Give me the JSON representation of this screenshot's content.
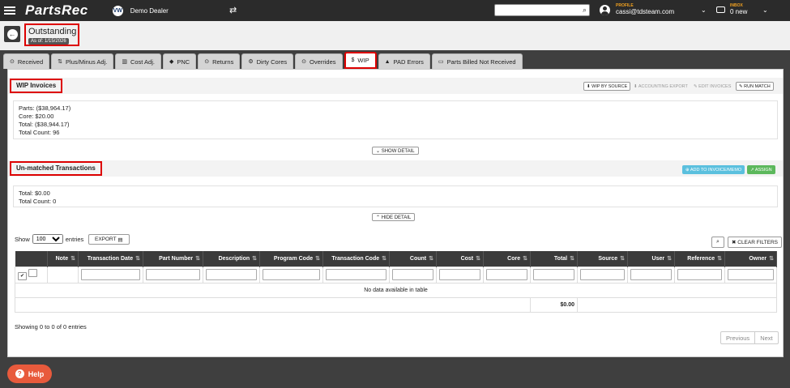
{
  "topbar": {
    "logo": "PartsRec",
    "dealer": "Demo Dealer",
    "profile_label": "PROFILE",
    "profile_email": "cassi@tdsteam.com",
    "inbox_label": "INBOX",
    "inbox_count": "0 new"
  },
  "header": {
    "title": "Outstanding",
    "as_of": "As of: 1/15/2026"
  },
  "tabs": [
    {
      "icon": "⊙",
      "label": "Received"
    },
    {
      "icon": "⇅",
      "label": "Plus/Minus Adj."
    },
    {
      "icon": "▥",
      "label": "Cost Adj."
    },
    {
      "icon": "◆",
      "label": "PNC"
    },
    {
      "icon": "⊙",
      "label": "Returns"
    },
    {
      "icon": "⚙",
      "label": "Dirty Cores"
    },
    {
      "icon": "⊙",
      "label": "Overrides"
    },
    {
      "icon": "$",
      "label": "WIP"
    },
    {
      "icon": "▲",
      "label": "PAD Errors"
    },
    {
      "icon": "▭",
      "label": "Parts Billed Not Received"
    }
  ],
  "wip": {
    "title": "WIP Invoices",
    "buttons": [
      "⬇ WIP BY SOURCE",
      "⬇ ACCOUNTING EXPORT",
      "✎ EDIT INVOICES",
      "✎ RUN MATCH"
    ],
    "parts": "Parts: ($38,964.17)",
    "core": "Core: $20.00",
    "total": "Total: ($38,944.17)",
    "count": "Total Count: 96",
    "toggle": "⌄ SHOW DETAIL"
  },
  "unmatched": {
    "title": "Un-matched Transactions",
    "add_button": "⊕ ADD TO INVOICE/MEMO",
    "assign_button": "↗ ASSIGN",
    "total": "Total: $0.00",
    "count": "Total Count: 0",
    "toggle": "⌃ HIDE DETAIL"
  },
  "table": {
    "show_label": "Show",
    "entries_value": "100",
    "entries_label": "entries",
    "export": "EXPORT",
    "clear_filters": "✖ CLEAR FILTERS",
    "columns": [
      "Note",
      "Transaction Date",
      "Part Number",
      "Description",
      "Program Code",
      "Transaction Code",
      "Count",
      "Cost",
      "Core",
      "Total",
      "Source",
      "User",
      "Reference",
      "Owner"
    ],
    "empty_message": "No data available in table",
    "total_value": "$0.00",
    "showing": "Showing 0 to 0 of 0 entries",
    "previous": "Previous",
    "next": "Next"
  },
  "help": "Help"
}
